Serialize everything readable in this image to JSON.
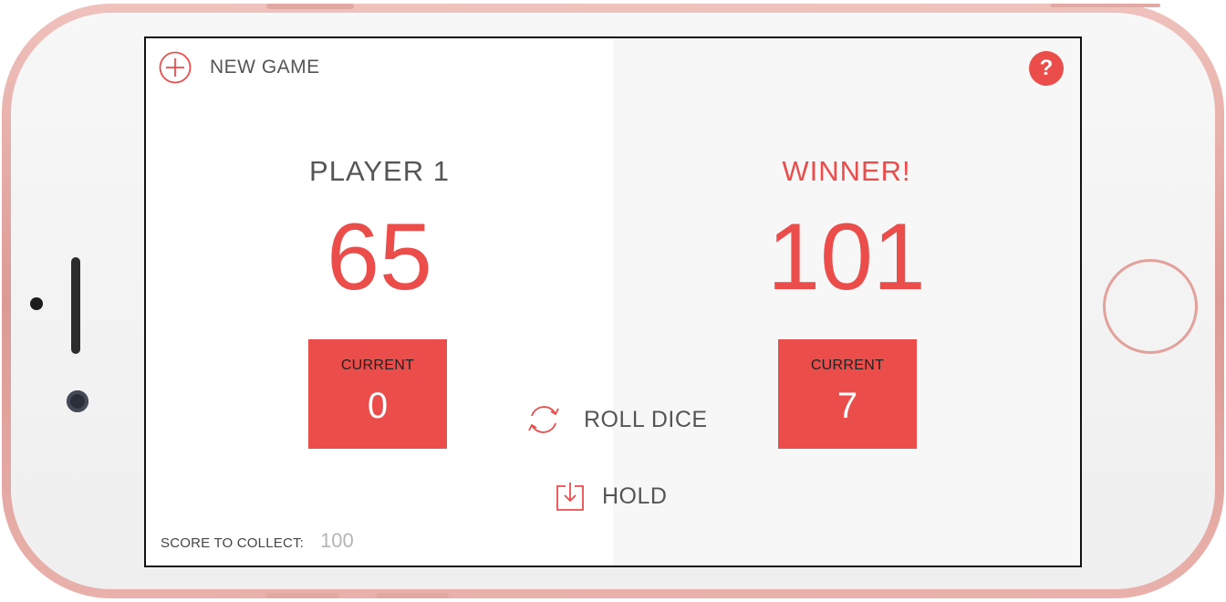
{
  "device": {
    "name": "phone",
    "frame_color": "#e8aba5",
    "face_color": "#f4f4f4"
  },
  "header": {
    "new_game_label": "NEW GAME",
    "new_game_icon": "plus-circle-icon",
    "help_label": "?"
  },
  "players": [
    {
      "name": "PLAYER 1",
      "score": "65",
      "current_label": "CURRENT",
      "current_value": "0",
      "is_winner": false
    },
    {
      "name": "WINNER!",
      "score": "101",
      "current_label": "CURRENT",
      "current_value": "7",
      "is_winner": true
    }
  ],
  "controls": {
    "roll_label": "ROLL DICE",
    "roll_icon": "refresh-icon",
    "hold_label": "HOLD",
    "hold_icon": "download-box-icon"
  },
  "footer": {
    "score_to_collect_label": "SCORE TO COLLECT:",
    "score_to_collect_value": "100"
  },
  "colors": {
    "accent": "#eb4d4b",
    "text_dark": "#555555",
    "panel_left_bg": "#ffffff",
    "panel_right_bg": "#f7f7f7",
    "placeholder_gray": "#b5b5b5"
  }
}
